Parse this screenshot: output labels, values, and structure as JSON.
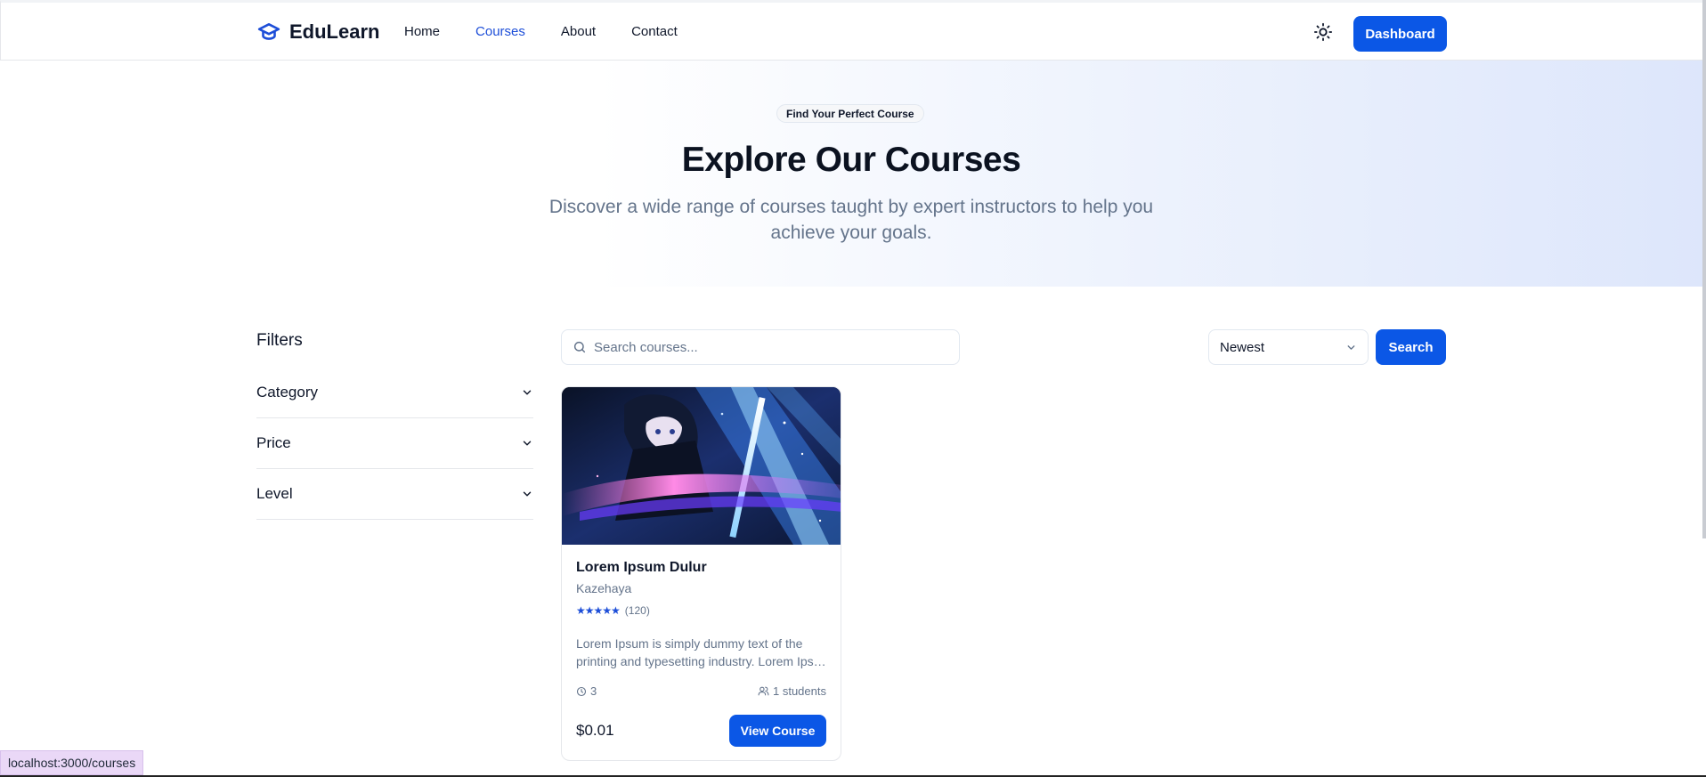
{
  "header": {
    "brand": "EduLearn",
    "nav": [
      {
        "label": "Home",
        "active": false
      },
      {
        "label": "Courses",
        "active": true
      },
      {
        "label": "About",
        "active": false
      },
      {
        "label": "Contact",
        "active": false
      }
    ],
    "dashboard_label": "Dashboard"
  },
  "hero": {
    "badge": "Find Your Perfect Course",
    "title": "Explore Our Courses",
    "subtitle": "Discover a wide range of courses taught by expert instructors to help you achieve your goals."
  },
  "filters": {
    "title": "Filters",
    "sections": [
      "Category",
      "Price",
      "Level"
    ]
  },
  "search": {
    "placeholder": "Search courses...",
    "sort_value": "Newest",
    "button_label": "Search"
  },
  "course": {
    "title": "Lorem Ipsum Dulur",
    "author": "Kazehaya",
    "stars": "★★★★★",
    "rating_count": "(120)",
    "description_line1": "Lorem Ipsum is simply dummy text of the",
    "description_line2": "printing and typesetting industry. Lorem Ipsum has been",
    "duration": "3",
    "students": "1 students",
    "price": "$0.01",
    "button_label": "View Course"
  },
  "status_bar": {
    "url": "localhost:3000/courses"
  },
  "colors": {
    "accent": "#0b57e6",
    "active_nav": "#1d4ed8"
  }
}
